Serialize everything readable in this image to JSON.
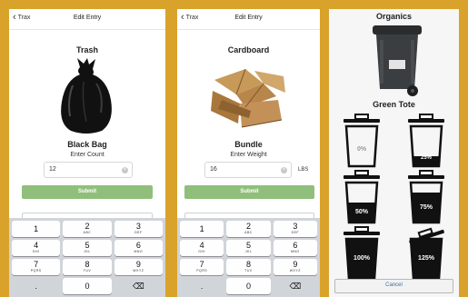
{
  "screen1": {
    "nav_back": "Trax",
    "nav_title": "Edit Entry",
    "item_title": "Trash",
    "item_sub": "Black Bag",
    "prompt": "Enter Count",
    "input_value": "12",
    "submit_label": "Submit"
  },
  "screen2": {
    "nav_back": "Trax",
    "nav_title": "Edit Entry",
    "item_title": "Cardboard",
    "item_sub": "Bundle",
    "prompt": "Enter Weight",
    "input_value": "16",
    "unit": "LBS",
    "submit_label": "Submit"
  },
  "screen3": {
    "title": "Organics",
    "cart_name": "Green Tote",
    "levels": [
      {
        "label": "0%",
        "fill": 0.0
      },
      {
        "label": "25%",
        "fill": 0.25
      },
      {
        "label": "50%",
        "fill": 0.5
      },
      {
        "label": "75%",
        "fill": 0.75
      },
      {
        "label": "100%",
        "fill": 1.0
      },
      {
        "label": "125%",
        "fill": 1.25
      }
    ],
    "cancel_label": "Cancel"
  },
  "keypad": [
    {
      "num": "1",
      "letters": ""
    },
    {
      "num": "2",
      "letters": "ABC"
    },
    {
      "num": "3",
      "letters": "DEF"
    },
    {
      "num": "4",
      "letters": "GHI"
    },
    {
      "num": "5",
      "letters": "JKL"
    },
    {
      "num": "6",
      "letters": "MNO"
    },
    {
      "num": "7",
      "letters": "PQRS"
    },
    {
      "num": "8",
      "letters": "TUV"
    },
    {
      "num": "9",
      "letters": "WXYZ"
    },
    {
      "num": ".",
      "letters": ""
    },
    {
      "num": "0",
      "letters": ""
    },
    {
      "num": "⌫",
      "letters": ""
    }
  ],
  "colors": {
    "background": "#d9a32b",
    "submit": "#8fbf7b",
    "keypad_bg": "#d1d4d9"
  }
}
